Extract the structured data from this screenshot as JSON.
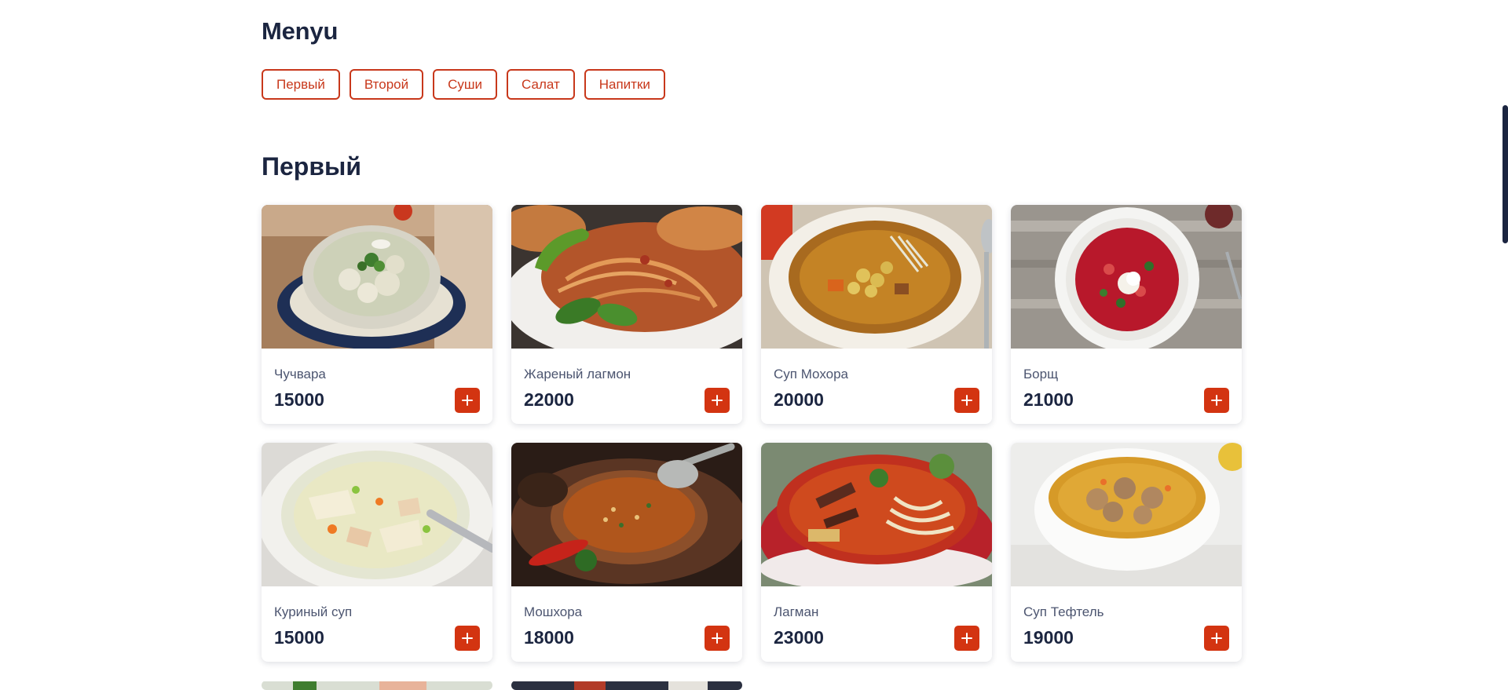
{
  "menu": {
    "title": "Menyu"
  },
  "filters": [
    "Первый",
    "Второй",
    "Суши",
    "Салат",
    "Напитки"
  ],
  "section": {
    "title": "Первый"
  },
  "items": [
    {
      "name": "Чучвара",
      "price": "15000",
      "photo": "dumpling-soup"
    },
    {
      "name": "Жареный лагмон",
      "price": "22000",
      "photo": "fried-noodles"
    },
    {
      "name": "Суп Мохора",
      "price": "20000",
      "photo": "chickpea-soup"
    },
    {
      "name": "Борщ",
      "price": "21000",
      "photo": "borscht"
    },
    {
      "name": "Куриный суп",
      "price": "15000",
      "photo": "chicken-noodle-soup"
    },
    {
      "name": "Мошхора",
      "price": "18000",
      "photo": "mung-bean-soup"
    },
    {
      "name": "Лагман",
      "price": "23000",
      "photo": "lagman"
    },
    {
      "name": "Суп Тефтель",
      "price": "19000",
      "photo": "meatball-soup"
    }
  ],
  "icons": {
    "add": "plus-icon"
  },
  "colors": {
    "accent": "#d33411",
    "outline": "#c8381b",
    "heading": "#1b2540",
    "muted": "#4c5570"
  }
}
